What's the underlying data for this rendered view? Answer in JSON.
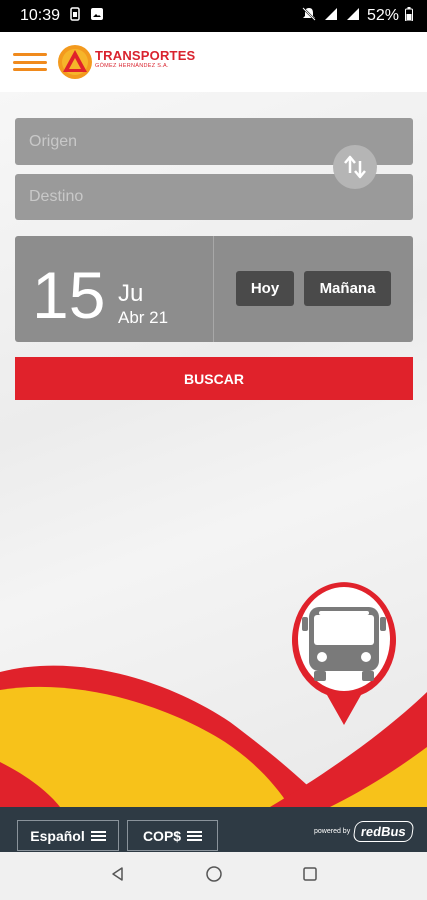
{
  "status_bar": {
    "time": "10:39",
    "battery": "52%"
  },
  "header": {
    "logo_title": "TRANSPORTES",
    "logo_subtitle": "GÓMEZ HERNÁNDEZ S.A."
  },
  "search": {
    "origin_placeholder": "Origen",
    "destination_placeholder": "Destino",
    "search_label": "BUSCAR"
  },
  "date": {
    "day": "15",
    "weekday": "Ju",
    "month_year": "Abr 21",
    "today_label": "Hoy",
    "tomorrow_label": "Mañana"
  },
  "footer": {
    "language": "Español",
    "currency": "COP$",
    "powered_by": "powered by",
    "partner": "redBus"
  },
  "colors": {
    "accent_red": "#e0222b",
    "brand_orange": "#f08a1c",
    "wave_yellow": "#f7c21a",
    "footer_bg": "#2e3a44"
  }
}
